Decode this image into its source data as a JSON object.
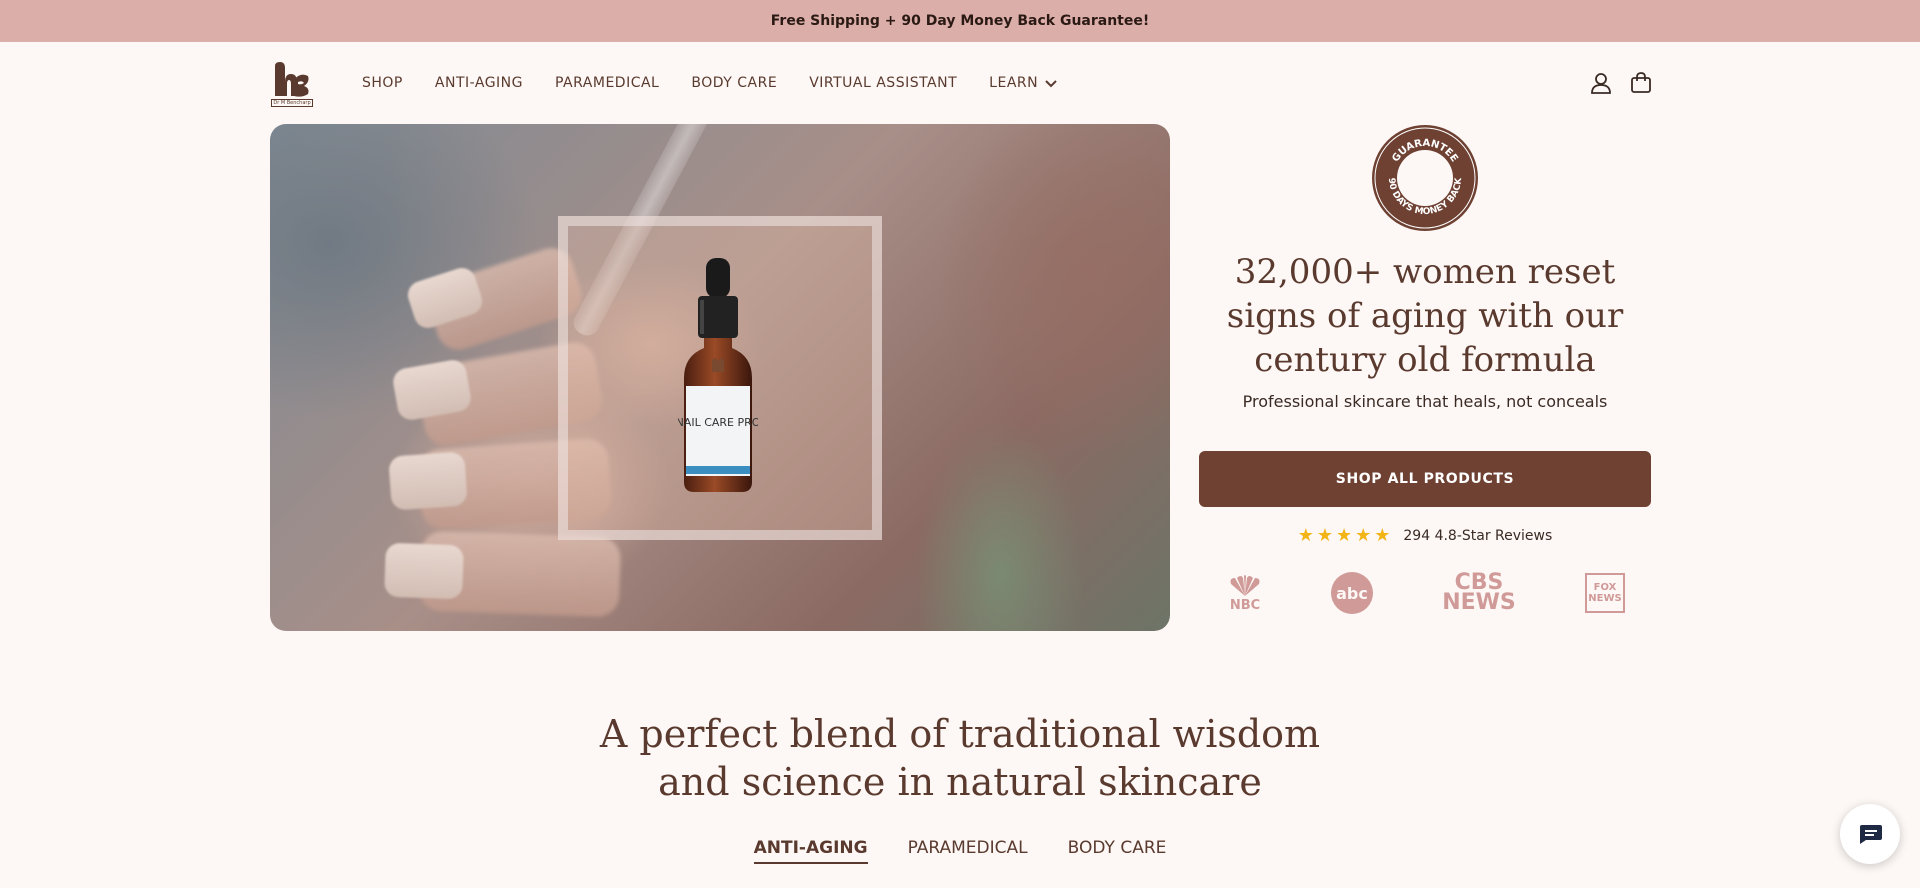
{
  "announcement": "Free Shipping + 90 Day Money Back Guarantee!",
  "logo": {
    "subtext": "Dr M Bencharp",
    "icon": "mb-logo"
  },
  "nav": {
    "items": [
      "SHOP",
      "ANTI-AGING",
      "PARAMEDICAL",
      "BODY CARE",
      "VIRTUAL ASSISTANT"
    ],
    "learn": "LEARN"
  },
  "header_icons": [
    "account-icon",
    "cart-icon"
  ],
  "hero": {
    "bottle_label": "NAIL CARE PRO"
  },
  "badge": {
    "top": "GUARANTEE",
    "bottom": "90 DAYS MONEY BACK"
  },
  "headline": "32,000+ women reset signs of aging with our century old formula",
  "subline": "Professional skincare that heals, not conceals",
  "cta": "SHOP ALL PRODUCTS",
  "reviews": {
    "stars": "★★★★★",
    "rating": 4.8,
    "text": "294 4.8-Star Reviews"
  },
  "press": [
    {
      "name": "NBC"
    },
    {
      "name": "abc"
    },
    {
      "name": "CBS NEWS"
    },
    {
      "name": "FOX NEWS"
    }
  ],
  "section_title_1": "A perfect blend of traditional wisdom",
  "section_title_2": "and science in natural skincare",
  "tabs": [
    {
      "label": "ANTI-AGING",
      "active": true
    },
    {
      "label": "PARAMEDICAL",
      "active": false
    },
    {
      "label": "BODY CARE",
      "active": false
    }
  ],
  "colors": {
    "brand": "#6e4133",
    "banner": "#dcaeaa",
    "star": "#f2b417",
    "press": "#d09a98"
  }
}
